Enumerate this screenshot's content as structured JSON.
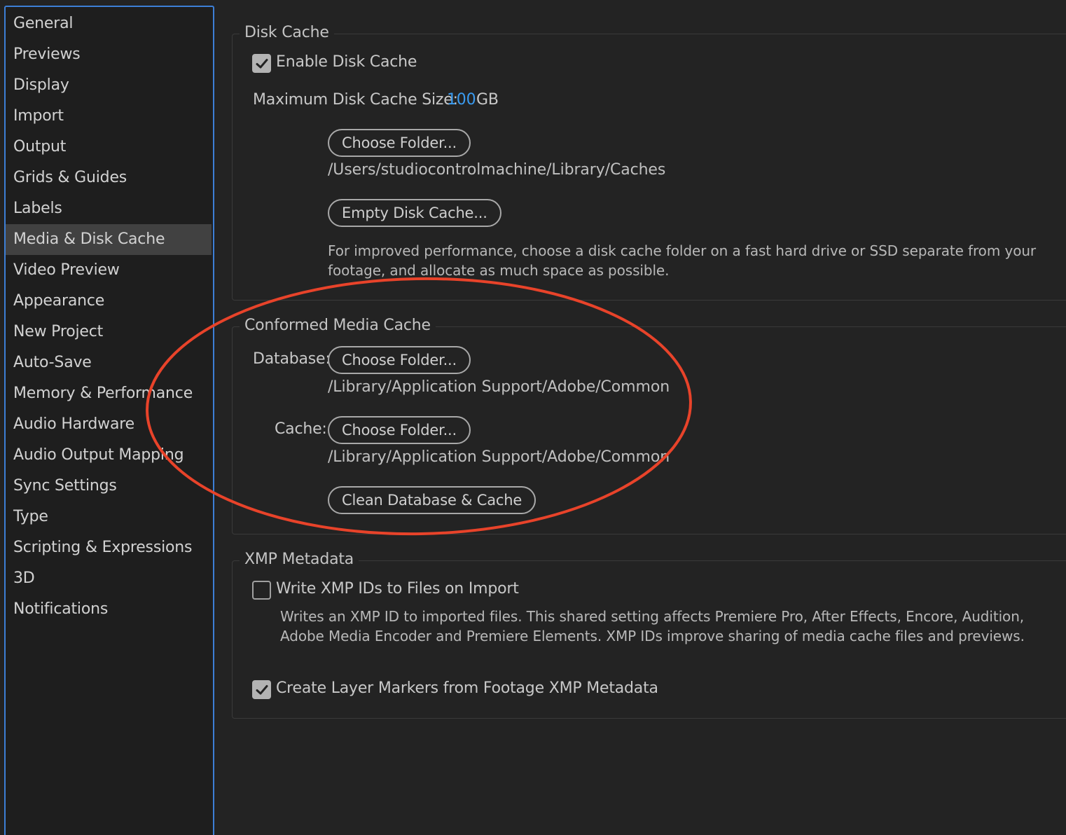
{
  "sidebar": {
    "items": [
      {
        "label": "General"
      },
      {
        "label": "Previews"
      },
      {
        "label": "Display"
      },
      {
        "label": "Import"
      },
      {
        "label": "Output"
      },
      {
        "label": "Grids & Guides"
      },
      {
        "label": "Labels"
      },
      {
        "label": "Media & Disk Cache",
        "selected": true
      },
      {
        "label": "Video Preview"
      },
      {
        "label": "Appearance"
      },
      {
        "label": "New Project"
      },
      {
        "label": "Auto-Save"
      },
      {
        "label": "Memory & Performance"
      },
      {
        "label": "Audio Hardware"
      },
      {
        "label": "Audio Output Mapping"
      },
      {
        "label": "Sync Settings"
      },
      {
        "label": "Type"
      },
      {
        "label": "Scripting & Expressions"
      },
      {
        "label": "3D"
      },
      {
        "label": "Notifications"
      }
    ]
  },
  "disk_cache": {
    "title": "Disk Cache",
    "enable_label": "Enable Disk Cache",
    "enable_checked": true,
    "max_size_label": "Maximum Disk Cache Size:",
    "max_size_value": "100",
    "max_size_unit": "GB",
    "choose_folder_label": "Choose Folder...",
    "folder_path": "/Users/studiocontrolmachine/Library/Caches",
    "empty_label": "Empty Disk Cache...",
    "note": "For improved performance, choose a disk cache folder on a fast hard drive or SSD separate from your footage, and allocate as much space as possible."
  },
  "conformed_media_cache": {
    "title": "Conformed Media Cache",
    "database_label": "Database:",
    "database_button": "Choose Folder...",
    "database_path": "/Library/Application Support/Adobe/Common",
    "cache_label": "Cache:",
    "cache_button": "Choose Folder...",
    "cache_path": "/Library/Application Support/Adobe/Common",
    "clean_button": "Clean Database & Cache"
  },
  "xmp_metadata": {
    "title": "XMP Metadata",
    "write_ids_label": "Write XMP IDs to Files on Import",
    "write_ids_checked": false,
    "write_ids_note": "Writes an XMP ID to imported files. This shared setting affects Premiere Pro, After Effects, Encore, Audition, Adobe Media Encoder and Premiere Elements. XMP IDs improve sharing of media cache files and previews.",
    "layer_markers_label": "Create Layer Markers from Footage XMP Metadata",
    "layer_markers_checked": true
  },
  "colors": {
    "background": "#232323",
    "sidebar_background": "#1e1e1e",
    "sidebar_border": "#3d7fd6",
    "selected_item": "#414141",
    "value_blue": "#3a9bf0",
    "annotation_red": "#e8432a"
  }
}
